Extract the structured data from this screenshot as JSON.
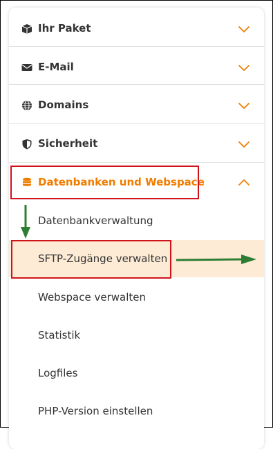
{
  "menu": {
    "sections": [
      {
        "label": "Ihr Paket",
        "icon": "box-icon",
        "expanded": false
      },
      {
        "label": "E-Mail",
        "icon": "envelope-icon",
        "expanded": false
      },
      {
        "label": "Domains",
        "icon": "globe-icon",
        "expanded": false
      },
      {
        "label": "Sicherheit",
        "icon": "shield-icon",
        "expanded": false
      },
      {
        "label": "Datenbanken und Webspace",
        "icon": "database-icon",
        "expanded": true
      }
    ],
    "subitems": [
      {
        "label": "Datenbankverwaltung"
      },
      {
        "label": "SFTP-Zugänge verwalten",
        "active": true
      },
      {
        "label": "Webspace verwalten"
      },
      {
        "label": "Statistik"
      },
      {
        "label": "Logfiles"
      },
      {
        "label": "PHP-Version einstellen"
      }
    ]
  },
  "colors": {
    "accent": "#f07d00",
    "highlight_bg": "#fdebd6",
    "annotation_red": "#d0121b",
    "annotation_arrow": "#2e7d32",
    "text": "#333333"
  }
}
